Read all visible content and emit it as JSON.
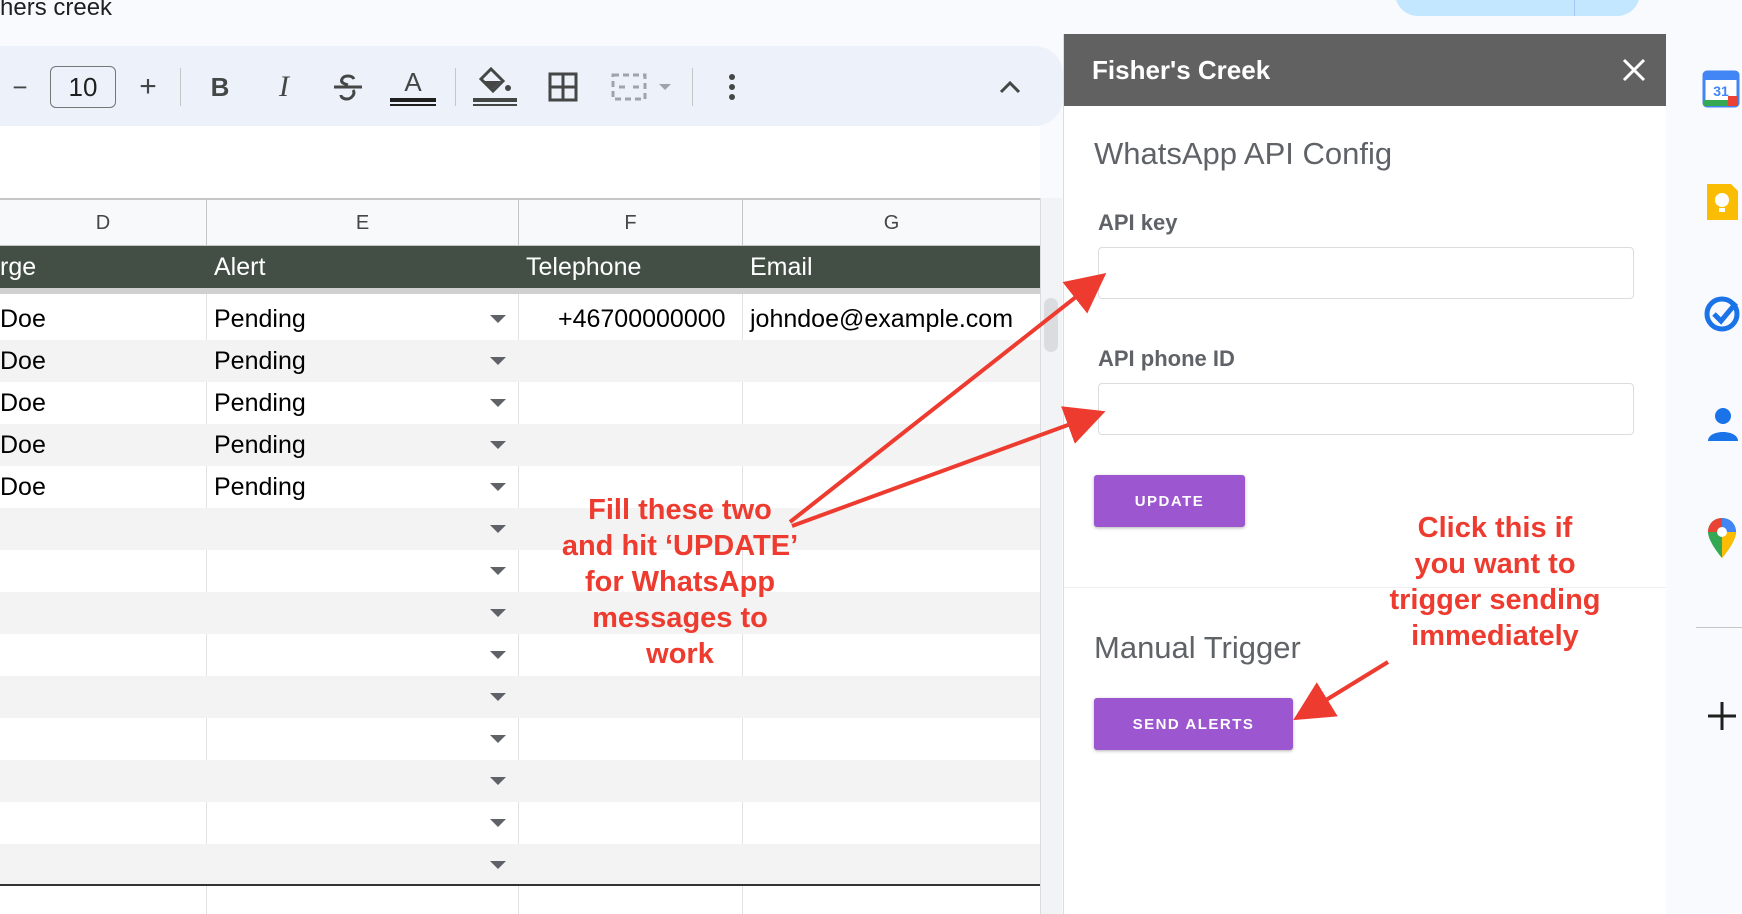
{
  "document": {
    "title": "hers creek"
  },
  "toolbar": {
    "decrease_font": "−",
    "font_size": "10",
    "increase_font": "+",
    "bold": "B",
    "italic": "I",
    "text_color_letter": "A",
    "more_icon": "more-vert-icon",
    "collapse_icon": "chevron-up-icon"
  },
  "sheet": {
    "columns": [
      "D",
      "E",
      "F",
      "G"
    ],
    "header_row": {
      "d": "rge",
      "alert": "Alert",
      "telephone": "Telephone",
      "email": "Email"
    },
    "header_color": "#434f45",
    "rows": [
      {
        "name": "Doe",
        "alert": "Pending",
        "telephone": "+46700000000",
        "email": "johndoe@example.com"
      },
      {
        "name": "Doe",
        "alert": "Pending",
        "telephone": "",
        "email": ""
      },
      {
        "name": "Doe",
        "alert": "Pending",
        "telephone": "",
        "email": ""
      },
      {
        "name": "Doe",
        "alert": "Pending",
        "telephone": "",
        "email": ""
      },
      {
        "name": "Doe",
        "alert": "Pending",
        "telephone": "",
        "email": ""
      }
    ]
  },
  "panel": {
    "title": "Fisher's Creek",
    "config_title": "WhatsApp API Config",
    "api_key_label": "API key",
    "api_key_value": "",
    "api_phone_label": "API phone ID",
    "api_phone_value": "",
    "update_button": "UPDATE",
    "trigger_title": "Manual Trigger",
    "send_button": "SEND ALERTS",
    "button_color": "#9c56d0",
    "header_color": "#616161"
  },
  "annotations": {
    "left_note": [
      "Fill these two",
      "and hit ‘UPDATE’",
      "for WhatsApp",
      "messages to",
      "work"
    ],
    "right_note": [
      "Click this if",
      "you want to",
      "trigger sending",
      "immediately"
    ],
    "color": "#ee3b2f"
  },
  "rail": {
    "icons": [
      "calendar-icon",
      "keep-icon",
      "tasks-icon",
      "contacts-icon",
      "maps-icon",
      "add-icon"
    ],
    "calendar_day": "31"
  }
}
